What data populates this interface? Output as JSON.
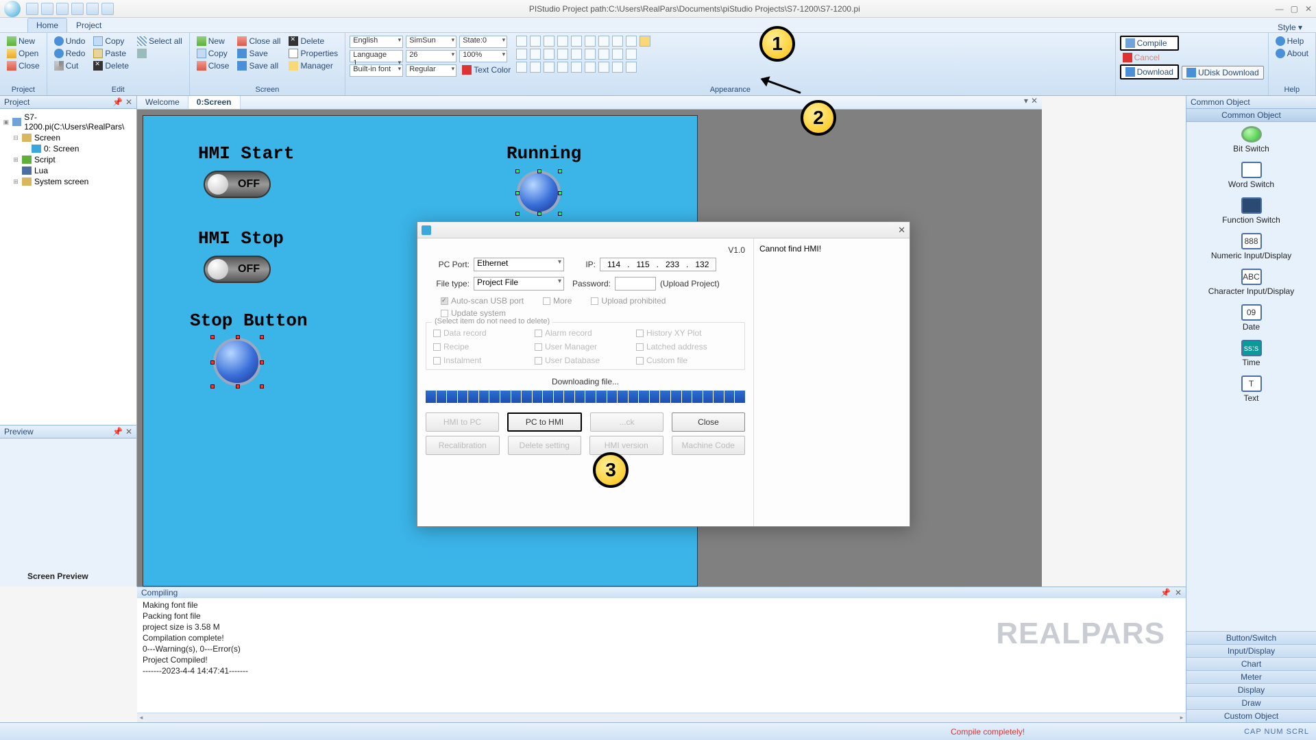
{
  "titlebar": {
    "title": "PIStudio   Project path:C:\\Users\\RealPars\\Documents\\piStudio Projects\\S7-1200\\S7-1200.pi",
    "style_link": "Style ▾"
  },
  "menu": {
    "tabs": [
      "Home",
      "Project"
    ],
    "active": 0
  },
  "ribbon": {
    "project": {
      "label": "Project",
      "new": "New",
      "open": "Open",
      "close": "Close"
    },
    "edit": {
      "label": "Edit",
      "undo": "Undo",
      "redo": "Redo",
      "cut": "Cut",
      "copy": "Copy",
      "paste": "Paste",
      "delete": "Delete",
      "selectall": "Select all"
    },
    "screen": {
      "label": "Screen",
      "new": "New",
      "copy": "Copy",
      "close": "Close",
      "closeall": "Close all",
      "save": "Save",
      "saveall": "Save all",
      "delete": "Delete",
      "properties": "Properties",
      "manager": "Manager"
    },
    "appearance": {
      "label": "Appearance",
      "lang": "English",
      "lang2": "Language 1",
      "builtin": "Built-in font",
      "font": "SimSun",
      "size": "26",
      "weight": "Regular",
      "state": "State:0",
      "zoom": "100%",
      "textcolor": "Text Color"
    },
    "tool": {
      "label": "",
      "compile": "Compile",
      "cancel": "Cancel",
      "download": "Download",
      "udisk": "UDisk Download"
    },
    "help": {
      "label": "Help",
      "help": "Help",
      "about": "About"
    }
  },
  "projectpanel": {
    "title": "Project",
    "root": "S7-1200.pi(C:\\Users\\RealPars\\",
    "nodes": [
      "Screen",
      "0: Screen",
      "Script",
      "Lua",
      "System screen"
    ]
  },
  "previewpanel": {
    "title": "Preview",
    "caption": "Screen Preview"
  },
  "doctabs": {
    "tabs": [
      "Welcome",
      "0:Screen"
    ],
    "active": 1
  },
  "screen_objects": {
    "lbl_start": "HMI Start",
    "lbl_stop": "HMI Stop",
    "lbl_stopbtn": "Stop Button",
    "lbl_running": "Running",
    "toggle_off": "OFF"
  },
  "rightpanel": {
    "title": "Common Object",
    "header": "Common Object",
    "items": [
      {
        "icon": "●",
        "color": "#27c427",
        "label": "Bit Switch"
      },
      {
        "icon": "▭",
        "color": "#2a4a73",
        "label": "Word Switch"
      },
      {
        "icon": "◧",
        "color": "#2a4a73",
        "label": "Function Switch"
      },
      {
        "icon": "888",
        "color": "#2a4a73",
        "label": "Numeric Input/Display"
      },
      {
        "icon": "ABC",
        "color": "#2a4a73",
        "label": "Character Input/Display"
      },
      {
        "icon": "09",
        "color": "#2a4a73",
        "label": "Date"
      },
      {
        "icon": "ss:s",
        "color": "#0aa",
        "label": "Time"
      },
      {
        "icon": "T",
        "color": "#2a4a73",
        "label": "Text"
      }
    ],
    "cats": [
      "Button/Switch",
      "Input/Display",
      "Chart",
      "Meter",
      "Display",
      "Draw",
      "Custom Object"
    ]
  },
  "output": {
    "title": "Compiling",
    "lines": [
      "Making font file",
      "Packing font file",
      "project size is 3.58 M",
      "Compilation complete!",
      "",
      "        0---Warning(s), 0---Error(s)",
      "",
      "Project Compiled!",
      "-------2023-4-4 14:47:41-------"
    ]
  },
  "statusbar": {
    "msg": "Compile completely!",
    "indicators": "CAP  NUM  SCRL"
  },
  "watermark": "REALPARS",
  "dialog": {
    "version": "V1.0",
    "pcport_label": "PC Port:",
    "pcport_val": "Ethernet",
    "ip_label": "IP:",
    "ip": [
      "114",
      "115",
      "233",
      "132"
    ],
    "filetype_label": "File type:",
    "filetype_val": "Project File",
    "password_label": "Password:",
    "upproj": "(Upload Project)",
    "autoscan": "Auto-scan USB port",
    "more": "More",
    "uploadproh": "Upload prohibited",
    "updatesys": "Update system",
    "group_legend": "(Select item do not need to delete)",
    "del_items": [
      "Data record",
      "Alarm record",
      "History XY Plot",
      "Recipe",
      "User Manager",
      "Latched address",
      "Instalment",
      "User Database",
      "Custom file"
    ],
    "status": "Downloading file...",
    "buttons": {
      "hmitopc": "HMI to PC",
      "pctohmi": "PC to HMI",
      "synclock": "...ck",
      "close": "Close",
      "recal": "Recalibration",
      "delset": "Delete setting",
      "hmiver": "HMI version",
      "machcode": "Machine Code"
    },
    "right_msg": "Cannot find HMI!"
  },
  "callouts": {
    "b1": "1",
    "b2": "2",
    "b3": "3"
  }
}
